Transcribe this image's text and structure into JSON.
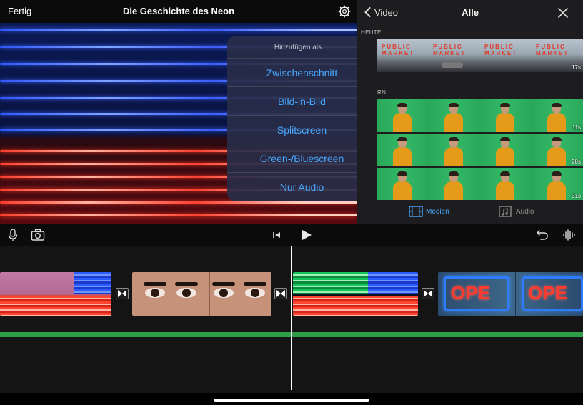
{
  "project_bar": {
    "done_label": "Fertig",
    "title": "Die Geschichte des Neon"
  },
  "popover": {
    "title": "Hinzufügen als ...",
    "items": [
      "Zwischenschnitt",
      "Bild-in-Bild",
      "Splitscreen",
      "Green-/Bluescreen",
      "Nur Audio"
    ],
    "item_color": "#4aa8ff"
  },
  "browser": {
    "back_label": "Video",
    "title": "Alle",
    "sections": [
      {
        "label": "HEUTE"
      },
      {
        "label": "RN"
      }
    ],
    "clip_durations": [
      "17s",
      "11s",
      "28s",
      "31s"
    ],
    "clip_sign_text": "PUBLIC MARKET",
    "tabs": [
      {
        "label": "Medien",
        "active": true,
        "icon": "film-icon"
      },
      {
        "label": "Audio",
        "active": false,
        "icon": "music-note-icon"
      }
    ]
  },
  "toolbar": {
    "icons": [
      "microphone-icon",
      "camera-icon",
      "skip-back-icon",
      "play-icon",
      "undo-icon",
      "waveform-icon"
    ]
  },
  "timeline": {
    "clip_text": "OPE",
    "audio_track_color": "#2e9e4a",
    "playhead_color": "#ffffff"
  },
  "colors": {
    "accent": "#4aa8ff",
    "background": "#141414"
  }
}
